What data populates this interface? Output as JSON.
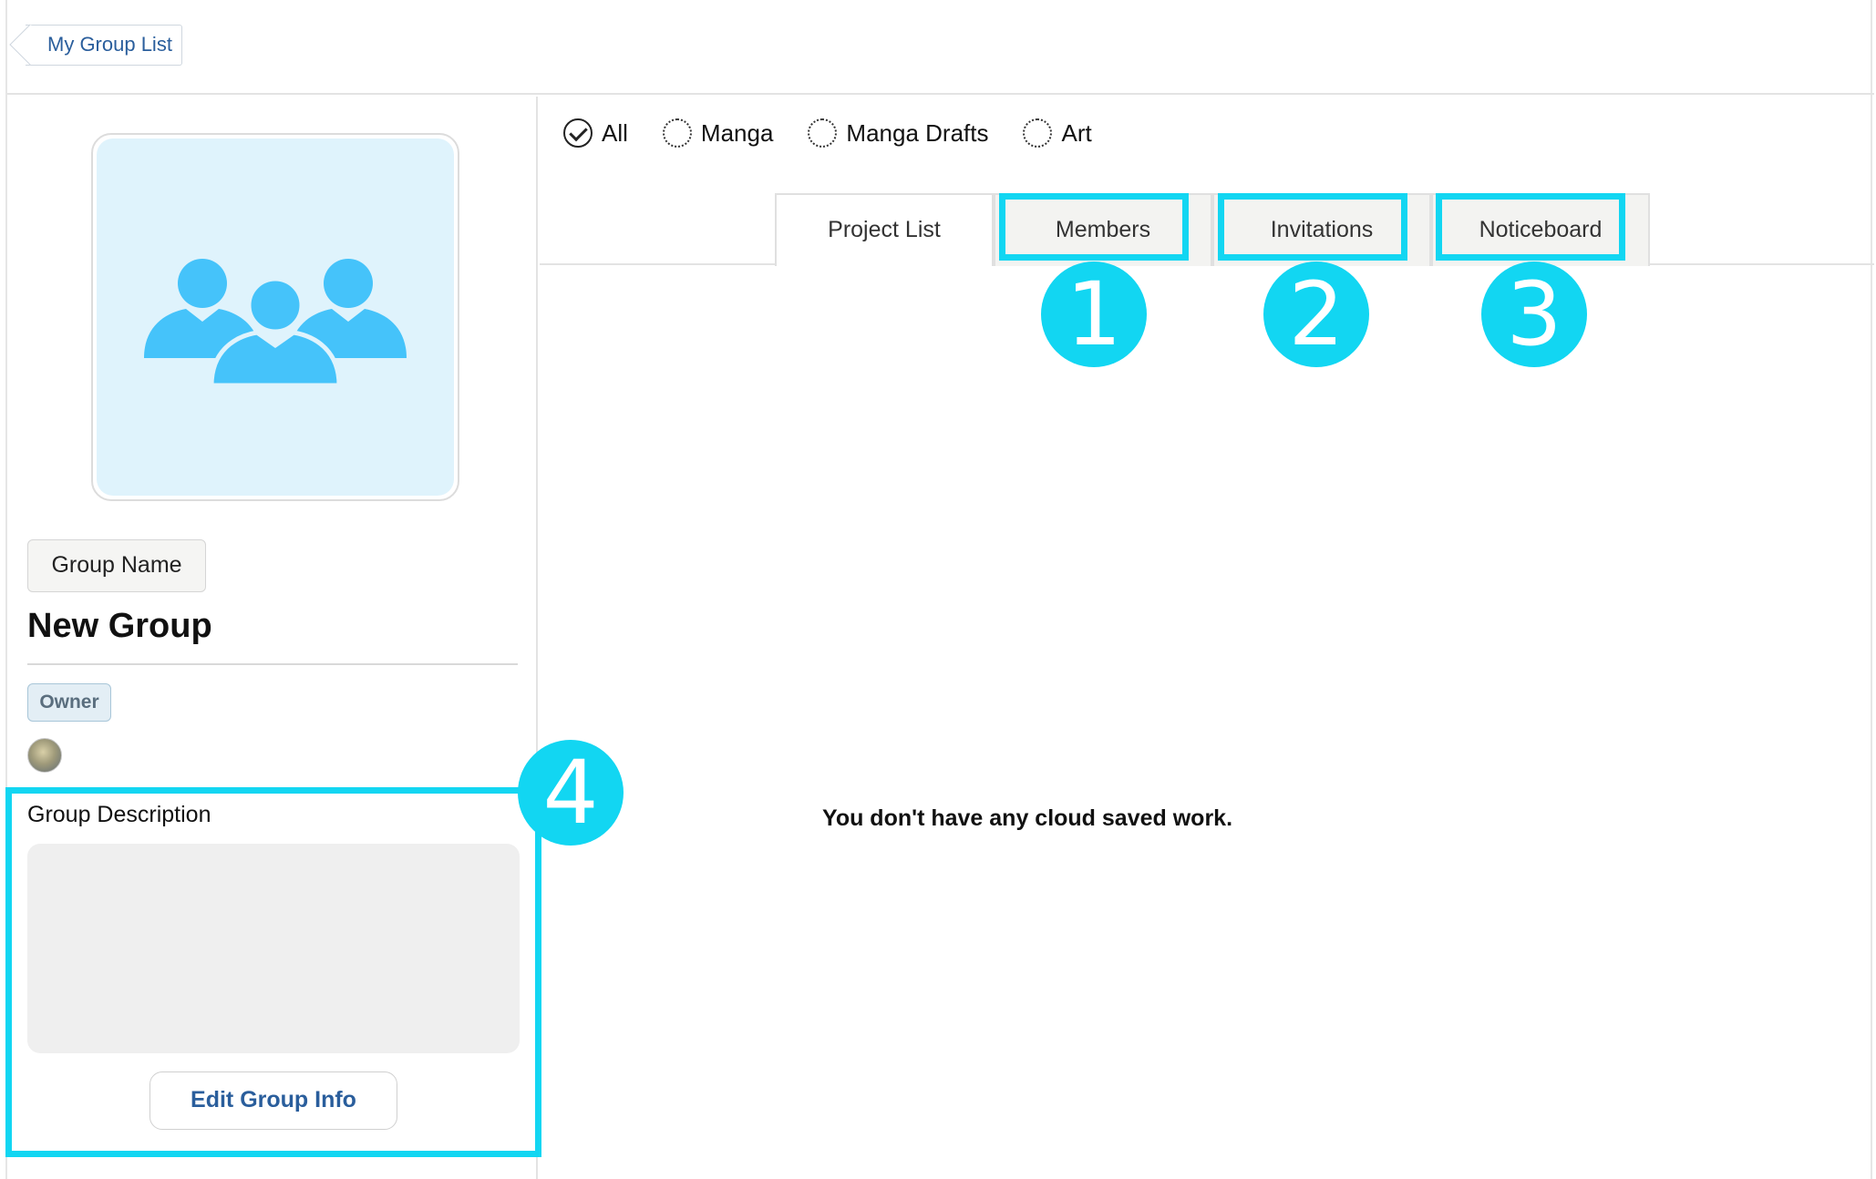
{
  "header": {
    "back_label": "My Group List"
  },
  "sidebar": {
    "avatar_icon": "group-people-icon",
    "group_name_button": "Group Name",
    "group_title": "New Group",
    "owner_badge": "Owner",
    "description_label": "Group Description",
    "description_value": "",
    "edit_button": "Edit Group Info"
  },
  "filters": [
    {
      "label": "All",
      "checked": true
    },
    {
      "label": "Manga",
      "checked": false
    },
    {
      "label": "Manga Drafts",
      "checked": false
    },
    {
      "label": "Art",
      "checked": false
    }
  ],
  "tabs": [
    {
      "label": "Project List",
      "active": true
    },
    {
      "label": "Members",
      "active": false
    },
    {
      "label": "Invitations",
      "active": false
    },
    {
      "label": "Noticeboard",
      "active": false
    }
  ],
  "main": {
    "empty_message": "You don't have any cloud saved work."
  },
  "annotations": {
    "numbers": [
      "1",
      "2",
      "3",
      "4"
    ],
    "color": "#12d6f2"
  },
  "colors": {
    "link_blue": "#2a5e9c",
    "avatar_bg": "#dff3fc",
    "avatar_icon": "#45c3fa"
  }
}
